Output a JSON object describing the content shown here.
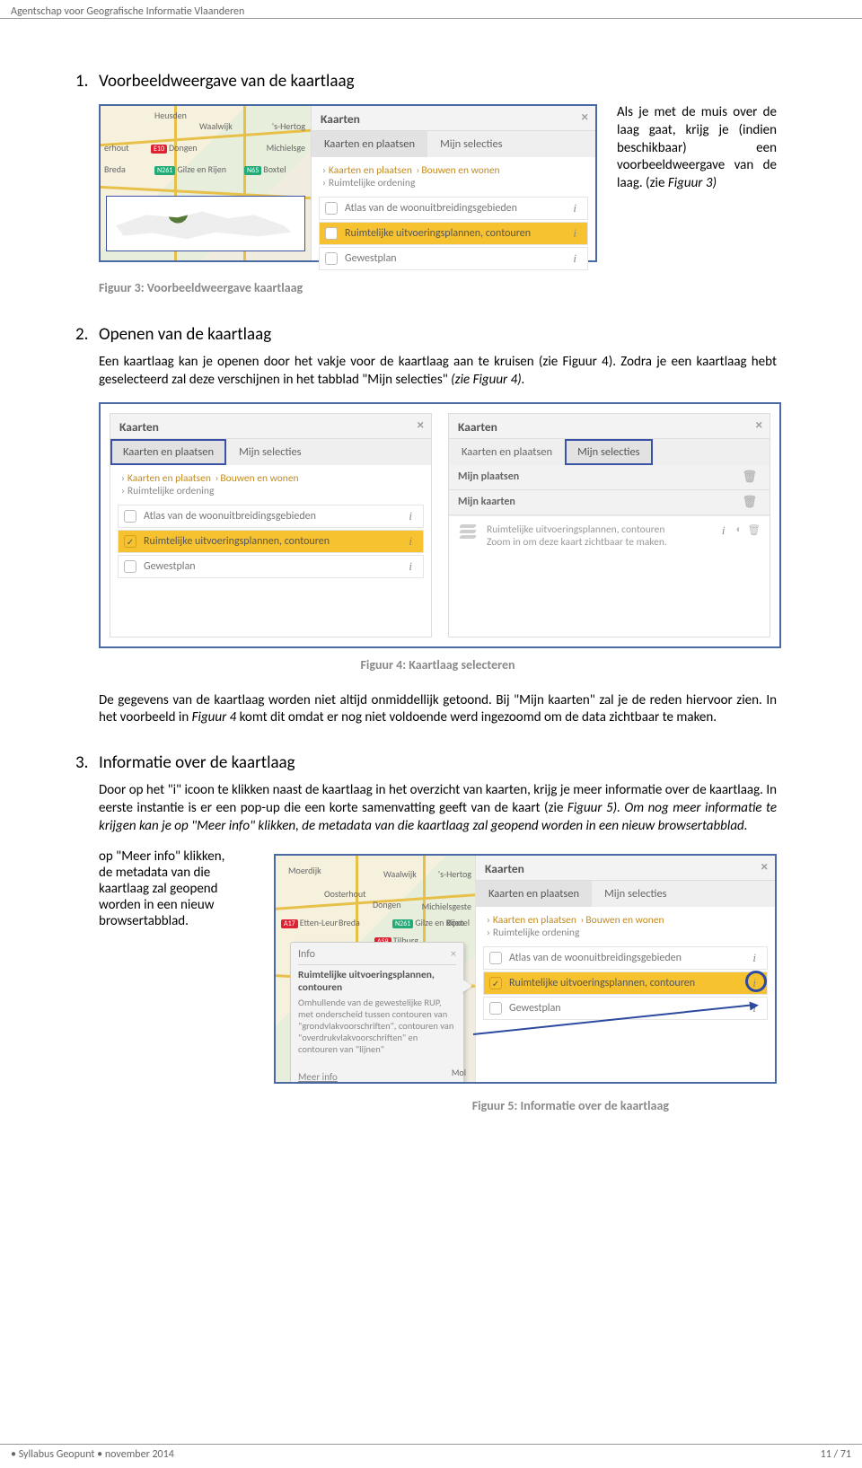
{
  "header": {
    "org": "Agentschap voor Geografische Informatie Vlaanderen"
  },
  "footer": {
    "left": "•  Syllabus Geopunt • november 2014",
    "right": "11 / 71"
  },
  "sec1": {
    "num": "1.",
    "title": "Voorbeeldweergave van de kaartlaag",
    "para": "Als je met de muis over de laag gaat, krijg je (indien beschikbaar) een voorbeeldweergave van de laag. (zie ",
    "para_ref": "Figuur 3",
    "para_tail": ")",
    "caption": "Figuur 3: Voorbeeldweergave kaartlaag",
    "panel": {
      "title": "Kaarten",
      "tabs": [
        "Kaarten en plaatsen",
        "Mijn selecties"
      ],
      "crumb1": "Kaarten en plaatsen",
      "crumb2": "Bouwen en wonen",
      "crumb3": "Ruimtelijke ordening",
      "layers": [
        "Atlas van de woonuitbreidingsgebieden",
        "Ruimtelijke uitvoeringsplannen, contouren",
        "Gewestplan"
      ],
      "map_labels": [
        "Heusden",
        "Waalwijk",
        "'s-Hertog",
        "erhout",
        "Dongen",
        "Michielsge",
        "Breda",
        "Gilze en Rijen",
        "Boxtel"
      ]
    }
  },
  "sec2": {
    "num": "2.",
    "title": "Openen van de kaartlaag",
    "para": "Een kaartlaag kan je openen door het vakje voor de kaartlaag aan te kruisen (zie Figuur 4). Zodra je een kaartlaag hebt geselecteerd zal deze verschijnen in het tabblad \"Mijn selecties\" ",
    "para_tail": "(zie Figuur 4).",
    "caption": "Figuur 4: Kaartlaag selecteren",
    "left": {
      "title": "Kaarten",
      "tabs": [
        "Kaarten en plaatsen",
        "Mijn selecties"
      ],
      "crumb1": "Kaarten en plaatsen",
      "crumb2": "Bouwen en wonen",
      "crumb3": "Ruimtelijke ordening",
      "layers": [
        "Atlas van de woonuitbreidingsgebieden",
        "Ruimtelijke uitvoeringsplannen, contouren",
        "Gewestplan"
      ]
    },
    "right": {
      "title": "Kaarten",
      "tabs": [
        "Kaarten en plaatsen",
        "Mijn selecties"
      ],
      "sub1": "Mijn plaatsen",
      "sub2": "Mijn kaarten",
      "rup_title": "Ruimtelijke uitvoeringsplannen, contouren",
      "rup_msg": "Zoom in om deze kaart zichtbaar te maken."
    },
    "para2": "De gegevens van de kaartlaag worden niet altijd onmiddellijk getoond. Bij \"Mijn kaarten\" zal je de reden hiervoor zien. In het voorbeeld in ",
    "para2_ref": "Figuur 4",
    "para2_tail": " komt dit omdat er nog niet voldoende werd ingezoomd om de data zichtbaar te maken."
  },
  "sec3": {
    "num": "3.",
    "title": "Informatie over de kaartlaag",
    "para_a": "Door op het \"i\" icoon te klikken naast de kaartlaag in het overzicht van kaarten, krijg je meer informatie over de kaartlaag. In eerste instantie is er een pop-up die een korte samenvatting geeft van de kaart (zie ",
    "para_a_ref": "Figuur 5",
    "para_a_tail": "). Om nog meer informatie te krijgen kan je op \"Meer info\" klikken, de metadata van die kaartlaag zal geopend worden in een nieuw browsertabblad.",
    "narrow_lines": [
      "op \"Meer info\" klikken,",
      "de metadata van die",
      "kaartlaag zal geopend",
      "worden in een nieuw",
      "browsertabblad."
    ],
    "caption": "Figuur 5: Informatie over de kaartlaag",
    "popup": {
      "head": "Info",
      "title": "Ruimtelijke uitvoeringsplannen, contouren",
      "body": "Omhullende van de gewestelijke RUP, met onderscheid tussen contouren van \"grondvlakvoorschriften\", contouren van \"overdrukvlakvoorschriften\" en contouren van \"lijnen\"",
      "more": "Meer info"
    },
    "panel": {
      "title": "Kaarten",
      "tabs": [
        "Kaarten en plaatsen",
        "Mijn selecties"
      ],
      "crumb1": "Kaarten en plaatsen",
      "crumb2": "Bouwen en wonen",
      "crumb3": "Ruimtelijke ordening",
      "layers": [
        "Atlas van de woonuitbreidingsgebieden",
        "Ruimtelijke uitvoeringsplannen, contouren",
        "Gewestplan"
      ]
    },
    "map_labels": [
      "Moerdijk",
      "Waalwijk",
      "'s-Hertog",
      "Oosterhout",
      "Dongen",
      "Michielsgeste",
      "Etten-Leur",
      "Breda",
      "Gilze en Rijen",
      "Boxtel",
      "Tilburg",
      "Mol"
    ]
  }
}
